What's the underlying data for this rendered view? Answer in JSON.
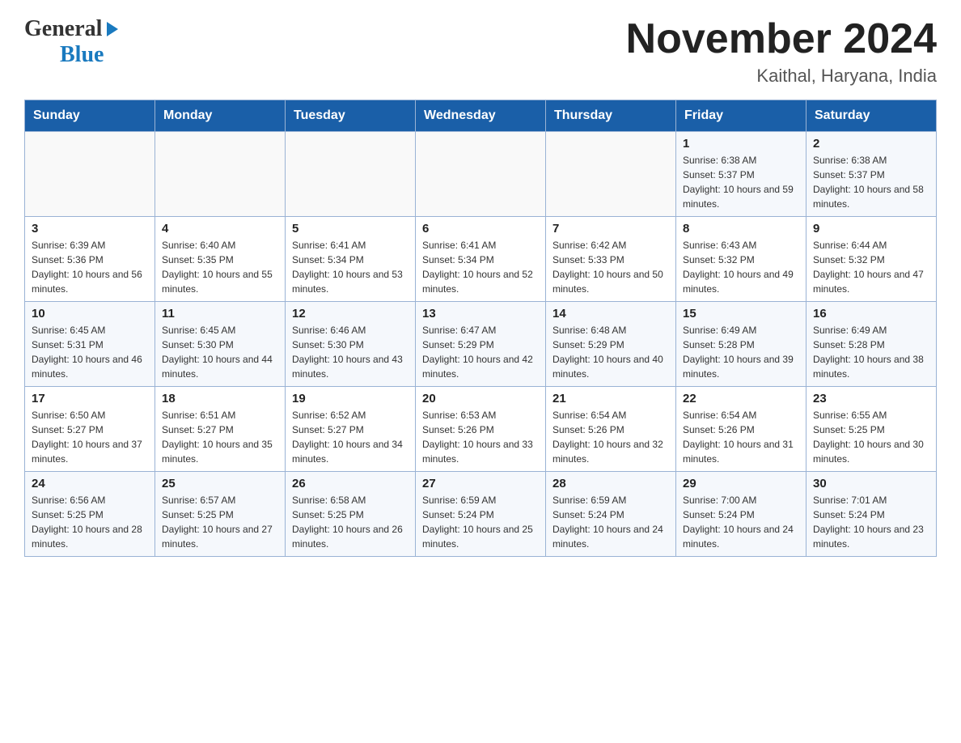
{
  "header": {
    "logo_general": "General",
    "logo_blue": "Blue",
    "title": "November 2024",
    "subtitle": "Kaithal, Haryana, India"
  },
  "weekdays": [
    "Sunday",
    "Monday",
    "Tuesday",
    "Wednesday",
    "Thursday",
    "Friday",
    "Saturday"
  ],
  "weeks": [
    [
      {
        "day": "",
        "info": ""
      },
      {
        "day": "",
        "info": ""
      },
      {
        "day": "",
        "info": ""
      },
      {
        "day": "",
        "info": ""
      },
      {
        "day": "",
        "info": ""
      },
      {
        "day": "1",
        "info": "Sunrise: 6:38 AM\nSunset: 5:37 PM\nDaylight: 10 hours and 59 minutes."
      },
      {
        "day": "2",
        "info": "Sunrise: 6:38 AM\nSunset: 5:37 PM\nDaylight: 10 hours and 58 minutes."
      }
    ],
    [
      {
        "day": "3",
        "info": "Sunrise: 6:39 AM\nSunset: 5:36 PM\nDaylight: 10 hours and 56 minutes."
      },
      {
        "day": "4",
        "info": "Sunrise: 6:40 AM\nSunset: 5:35 PM\nDaylight: 10 hours and 55 minutes."
      },
      {
        "day": "5",
        "info": "Sunrise: 6:41 AM\nSunset: 5:34 PM\nDaylight: 10 hours and 53 minutes."
      },
      {
        "day": "6",
        "info": "Sunrise: 6:41 AM\nSunset: 5:34 PM\nDaylight: 10 hours and 52 minutes."
      },
      {
        "day": "7",
        "info": "Sunrise: 6:42 AM\nSunset: 5:33 PM\nDaylight: 10 hours and 50 minutes."
      },
      {
        "day": "8",
        "info": "Sunrise: 6:43 AM\nSunset: 5:32 PM\nDaylight: 10 hours and 49 minutes."
      },
      {
        "day": "9",
        "info": "Sunrise: 6:44 AM\nSunset: 5:32 PM\nDaylight: 10 hours and 47 minutes."
      }
    ],
    [
      {
        "day": "10",
        "info": "Sunrise: 6:45 AM\nSunset: 5:31 PM\nDaylight: 10 hours and 46 minutes."
      },
      {
        "day": "11",
        "info": "Sunrise: 6:45 AM\nSunset: 5:30 PM\nDaylight: 10 hours and 44 minutes."
      },
      {
        "day": "12",
        "info": "Sunrise: 6:46 AM\nSunset: 5:30 PM\nDaylight: 10 hours and 43 minutes."
      },
      {
        "day": "13",
        "info": "Sunrise: 6:47 AM\nSunset: 5:29 PM\nDaylight: 10 hours and 42 minutes."
      },
      {
        "day": "14",
        "info": "Sunrise: 6:48 AM\nSunset: 5:29 PM\nDaylight: 10 hours and 40 minutes."
      },
      {
        "day": "15",
        "info": "Sunrise: 6:49 AM\nSunset: 5:28 PM\nDaylight: 10 hours and 39 minutes."
      },
      {
        "day": "16",
        "info": "Sunrise: 6:49 AM\nSunset: 5:28 PM\nDaylight: 10 hours and 38 minutes."
      }
    ],
    [
      {
        "day": "17",
        "info": "Sunrise: 6:50 AM\nSunset: 5:27 PM\nDaylight: 10 hours and 37 minutes."
      },
      {
        "day": "18",
        "info": "Sunrise: 6:51 AM\nSunset: 5:27 PM\nDaylight: 10 hours and 35 minutes."
      },
      {
        "day": "19",
        "info": "Sunrise: 6:52 AM\nSunset: 5:27 PM\nDaylight: 10 hours and 34 minutes."
      },
      {
        "day": "20",
        "info": "Sunrise: 6:53 AM\nSunset: 5:26 PM\nDaylight: 10 hours and 33 minutes."
      },
      {
        "day": "21",
        "info": "Sunrise: 6:54 AM\nSunset: 5:26 PM\nDaylight: 10 hours and 32 minutes."
      },
      {
        "day": "22",
        "info": "Sunrise: 6:54 AM\nSunset: 5:26 PM\nDaylight: 10 hours and 31 minutes."
      },
      {
        "day": "23",
        "info": "Sunrise: 6:55 AM\nSunset: 5:25 PM\nDaylight: 10 hours and 30 minutes."
      }
    ],
    [
      {
        "day": "24",
        "info": "Sunrise: 6:56 AM\nSunset: 5:25 PM\nDaylight: 10 hours and 28 minutes."
      },
      {
        "day": "25",
        "info": "Sunrise: 6:57 AM\nSunset: 5:25 PM\nDaylight: 10 hours and 27 minutes."
      },
      {
        "day": "26",
        "info": "Sunrise: 6:58 AM\nSunset: 5:25 PM\nDaylight: 10 hours and 26 minutes."
      },
      {
        "day": "27",
        "info": "Sunrise: 6:59 AM\nSunset: 5:24 PM\nDaylight: 10 hours and 25 minutes."
      },
      {
        "day": "28",
        "info": "Sunrise: 6:59 AM\nSunset: 5:24 PM\nDaylight: 10 hours and 24 minutes."
      },
      {
        "day": "29",
        "info": "Sunrise: 7:00 AM\nSunset: 5:24 PM\nDaylight: 10 hours and 24 minutes."
      },
      {
        "day": "30",
        "info": "Sunrise: 7:01 AM\nSunset: 5:24 PM\nDaylight: 10 hours and 23 minutes."
      }
    ]
  ]
}
